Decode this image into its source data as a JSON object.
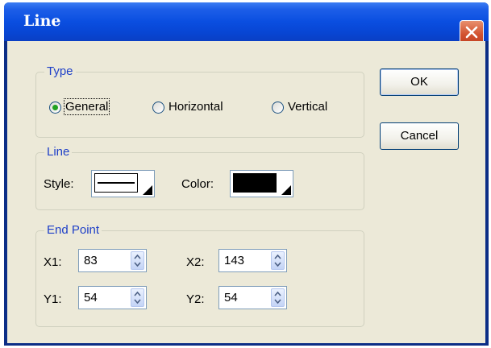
{
  "window": {
    "title": "Line"
  },
  "type_group": {
    "legend": "Type",
    "options": [
      {
        "label": "General",
        "checked": true
      },
      {
        "label": "Horizontal",
        "checked": false
      },
      {
        "label": "Vertical",
        "checked": false
      }
    ]
  },
  "line_group": {
    "legend": "Line",
    "style_label": "Style:",
    "color_label": "Color:",
    "color_value": "#000000"
  },
  "endpoint_group": {
    "legend": "End Point",
    "x1_label": "X1:",
    "x1_value": "83",
    "x2_label": "X2:",
    "x2_value": "143",
    "y1_label": "Y1:",
    "y1_value": "54",
    "y2_label": "Y2:",
    "y2_value": "54"
  },
  "buttons": {
    "ok": "OK",
    "cancel": "Cancel"
  },
  "colors": {
    "accent": "#1f40c8",
    "title_bar": "#0a4ee0",
    "close": "#d2522f"
  }
}
